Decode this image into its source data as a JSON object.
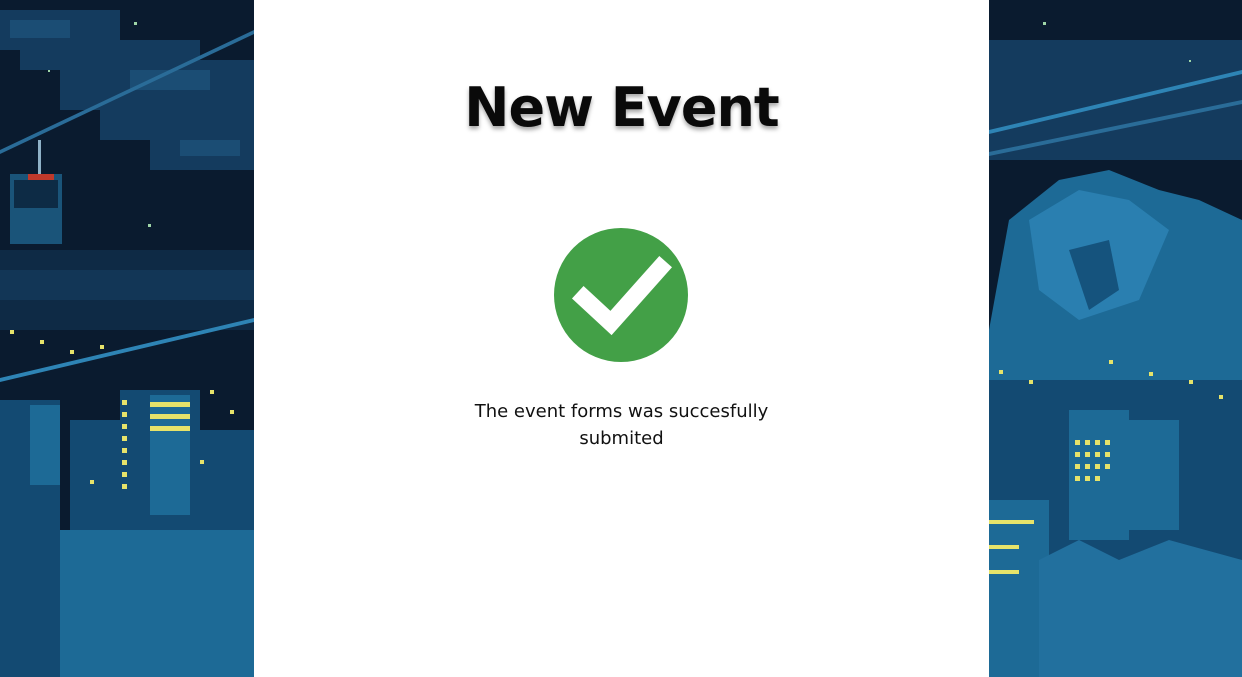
{
  "page": {
    "title": "New Event",
    "message": "The event forms was succesfully submited",
    "status_icon": "check-circle-icon"
  },
  "colors": {
    "card_background": "#ffffff",
    "success_green": "#43a047",
    "title_text": "#0a0a0a",
    "scene_sky": "#0b1e33",
    "scene_blue": "#1d6a96",
    "window_light": "#e6e36a"
  }
}
